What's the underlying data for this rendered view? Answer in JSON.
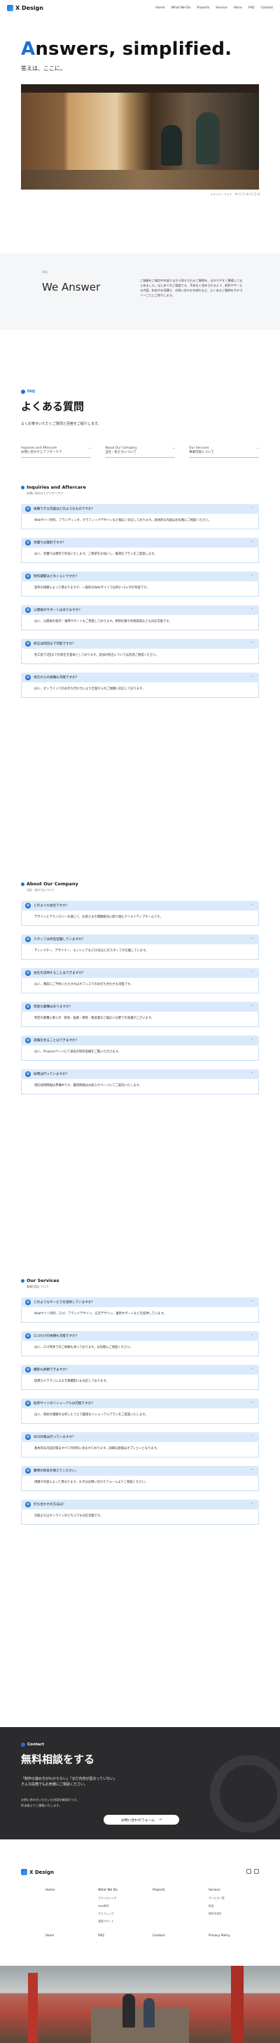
{
  "header": {
    "logo_text": "X Design",
    "nav": [
      "Home",
      "What We Do",
      "Projects",
      "Service",
      "Voice",
      "FAQ",
      "Contact"
    ]
  },
  "hero": {
    "title_first": "A",
    "title_rest": "nswers, simplified.",
    "subtitle": "答えは、ここに。",
    "photo_caption": "イメージ・フォト　京 〇 〇 寺 〇 〇 社"
  },
  "we_answer": {
    "small_label": "FAQ",
    "title": "We Answer",
    "text": "ご依頼をご検討中の皆さまから寄せられるご質問を、分かりやすく整理してまとめました。はじめてのご相談でも、不安なく进められるよう、制作やサービス内容、料金やお見積り、お問い合わせの流れなど、よくあるご質問をカテゴリーごとにご紹介します。"
  },
  "faq": {
    "label": "FAQ",
    "title": "よくある質問",
    "lead": "よくお寄せいただくご質問と回答をご紹介します。",
    "categories": [
      {
        "en": "Inquiries and Aftercare",
        "ja": "お問い合わせとアフターケア"
      },
      {
        "en": "About Our Company",
        "ja": "当社・私たちについて"
      },
      {
        "en": "Our Services",
        "ja": "事業内容について"
      }
    ]
  },
  "sections": [
    {
      "title": "Inquiries and Aftercare",
      "subtitle": "お問い合わせとアフターケア",
      "items": [
        {
          "q": "依頼できる内容はどのようなものですか？",
          "a": "Webサイト制作、ブランディング、グラフィックデザインなど幅広く対応しております。具体的な内容はお気軽にご相談ください。"
        },
        {
          "q": "見積りは無料ですか？",
          "a": "はい、見積りは無料で作成いたします。ご要望をお伺いし、最適なプランをご提案します。"
        },
        {
          "q": "制作期間はどのくらいですか？",
          "a": "案件の規模によって異なりますが、一般的なWebサイトでは約1〜3ヶ月が目安です。"
        },
        {
          "q": "公開後のサポートはありますか？",
          "a": "はい、公開後の保守・運用サポートもご用意しております。更新作業や改善提案なども対応可能です。"
        },
        {
          "q": "修正は何回まで可能ですか？",
          "a": "各工程で2回までの修正を基本としております。追加の修正については別途ご相談ください。"
        },
        {
          "q": "地方からの依頼も可能ですか？",
          "a": "はい、オンラインでのお打ち合わせにより全国からのご依頼に対応しております。"
        }
      ]
    },
    {
      "title": "About Our Company",
      "subtitle": "当社・私たちについて",
      "items": [
        {
          "q": "どのような会社ですか？",
          "a": "デザインとテクノロジーを通じて、お客さまの課題解決に取り組むクリエイティブチームです。"
        },
        {
          "q": "スタッフは何名在籍していますか？",
          "a": "ディレクター、デザイナー、エンジニアなど10名ほどのスタッフが在籍しています。"
        },
        {
          "q": "会社を訪問することはできますか？",
          "a": "はい、事前にご予約いただければオフィスでのお打ち合わせも可能です。"
        },
        {
          "q": "得意な業種はありますか？",
          "a": "特定の業種に限らず、飲食・医療・教育・製造業など幅広い分野での実績がございます。"
        },
        {
          "q": "実績を見ることはできますか？",
          "a": "はい、Projectsページにて過去の制作実績をご覧いただけます。"
        },
        {
          "q": "採用は行っていますか？",
          "a": "現在採用情報は準備中です。最新情報はお知らせページにてご案内いたします。"
        }
      ]
    },
    {
      "title": "Our Services",
      "subtitle": "事業内容について",
      "items": [
        {
          "q": "どのようなサービスを提供していますか？",
          "a": "Webサイト制作、ロゴ・ブランドデザイン、広告デザイン、運用サポートなどを提供しています。"
        },
        {
          "q": "ロゴだけの依頼も可能ですか？",
          "a": "はい、ロゴ単体でのご依頼も承っております。お気軽にご相談ください。"
        },
        {
          "q": "撮影も依頼できますか？",
          "a": "提携カメラマンによる写真撮影にも対応しております。"
        },
        {
          "q": "既存サイトのリニューアルは可能ですか？",
          "a": "はい、現状の課題を分析したうえで最適なリニューアルプランをご提案いたします。"
        },
        {
          "q": "SEO対策は行っていますか？",
          "a": "基本的な内部対策はすべての制作に含まれております。詳細な施策はオプションとなります。"
        },
        {
          "q": "費用の目安を教えてください。",
          "a": "規模や内容によって異なります。まずはお問い合わせフォームよりご相談ください。"
        },
        {
          "q": "打ち合わせの方法は？",
          "a": "対面またはオンラインのどちらでも対応可能です。"
        }
      ]
    }
  ],
  "contact": {
    "label": "Contact",
    "title": "無料相談をする",
    "lead_1": "「制作の進め方がわからない」「まだ内容が固まっていない」",
    "lead_2": "そんな段階でもお気軽にご相談ください。",
    "note_1": "お問い合わせいただいた内容を確認のうえ、",
    "note_2": "担当者よりご連絡いたします。",
    "button": "お問い合わせフォーム",
    "button_arrow": "→"
  },
  "footer": {
    "logo_text": "X Design",
    "columns": [
      {
        "head": "Home",
        "subs": []
      },
      {
        "head": "What We Do",
        "subs": [
          "ブランディング",
          "Web制作",
          "グラフィック",
          "運用サポート"
        ]
      },
      {
        "head": "Projects",
        "subs": []
      },
      {
        "head": "Service",
        "subs": [
          "サービス一覧",
          "料金",
          "制作の流れ"
        ]
      }
    ],
    "bottom": [
      "Voice",
      "FAQ",
      "Contact",
      "Privacy Policy"
    ]
  }
}
